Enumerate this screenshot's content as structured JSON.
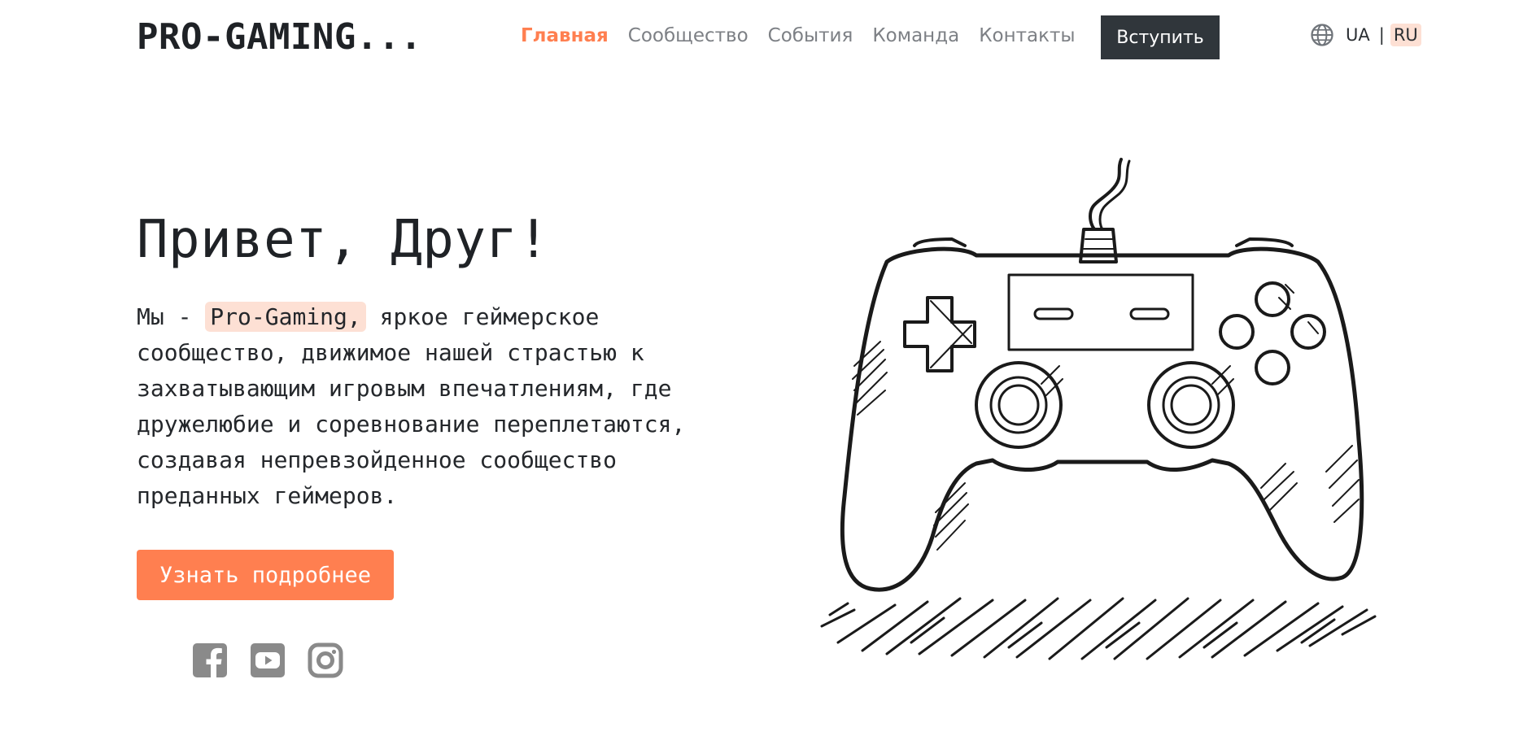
{
  "header": {
    "logo": "PRO-GAMING...",
    "nav": [
      {
        "label": "Главная",
        "active": true
      },
      {
        "label": "Сообщество",
        "active": false
      },
      {
        "label": "События",
        "active": false
      },
      {
        "label": "Команда",
        "active": false
      },
      {
        "label": "Контакты",
        "active": false
      }
    ],
    "join_label": "Вступить",
    "lang": {
      "ua": "UA",
      "separator": "|",
      "ru": "RU",
      "selected": "RU"
    }
  },
  "hero": {
    "title": "Привет, Друг!",
    "text_before": "Мы - ",
    "highlight": "Pro-Gaming,",
    "text_after": " яркое геймерское сообщество, движимое нашей страстью к захватывающим игровым впечатлениям, где дружелюбие и соревнование переплетаются, создавая непревзойденное сообщество преданных геймеров.",
    "cta_label": "Узнать подробнее"
  },
  "socials": [
    {
      "icon": "facebook-icon"
    },
    {
      "icon": "youtube-icon"
    },
    {
      "icon": "instagram-icon"
    }
  ],
  "illustration": {
    "icon": "gamepad-illustration"
  },
  "colors": {
    "accent": "#ff7f50",
    "highlight_bg": "#fde0d4",
    "dark_button": "#30363b",
    "nav_text": "#7d8085",
    "social_icon": "#8a8a8a"
  }
}
